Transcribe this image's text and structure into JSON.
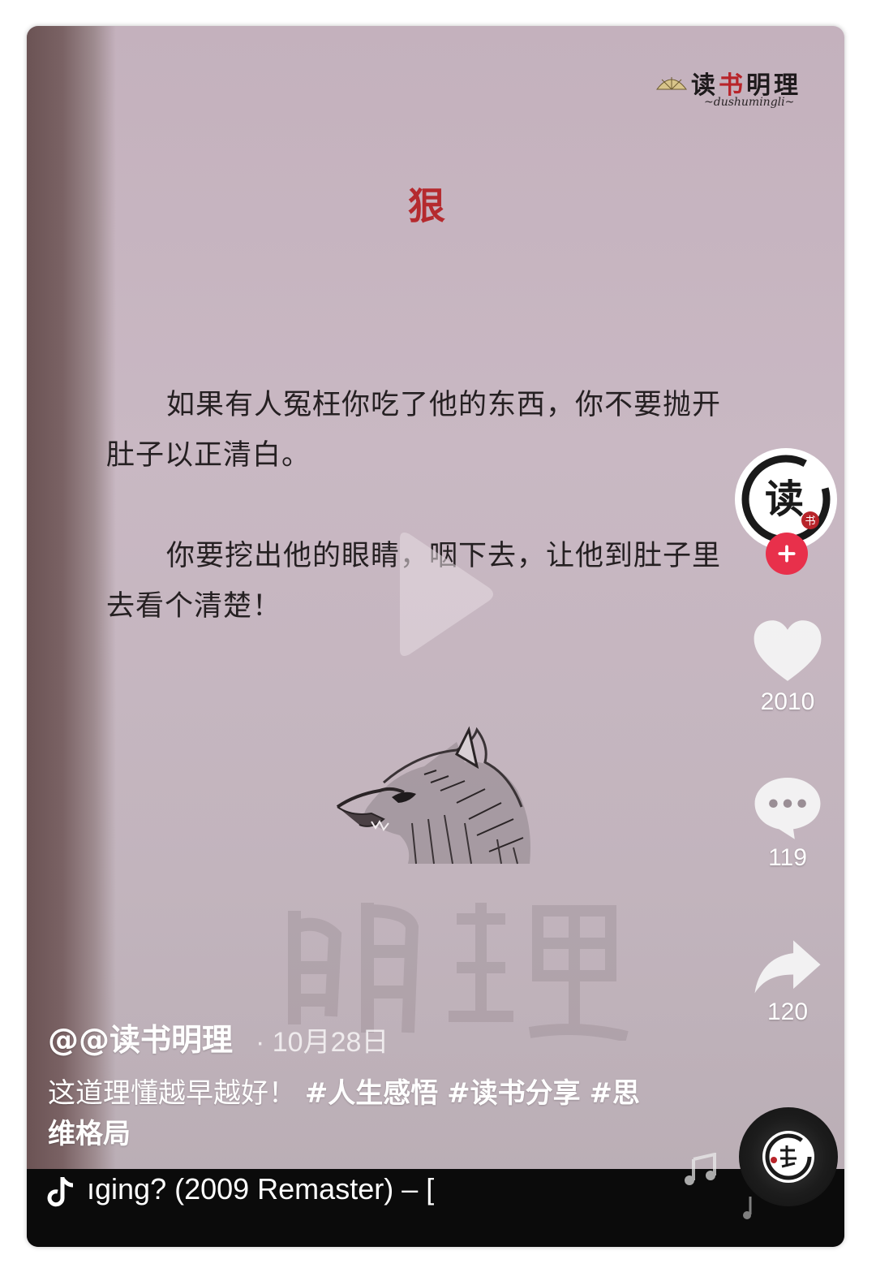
{
  "brand": {
    "title_a": "读",
    "title_b": "书",
    "title_c": "明理",
    "subtitle": "~dushumingli~"
  },
  "post": {
    "title": "狠",
    "paragraph1": "如果有人冤枉你吃了他的东西，你不要抛开肚子以正清白。",
    "paragraph2": "你要挖出他的眼睛，咽下去，让他到肚子里去看个清楚！"
  },
  "avatar": {
    "glyph": "读",
    "seal": "书"
  },
  "actions": {
    "likes": "2010",
    "comments": "119",
    "shares": "120"
  },
  "meta": {
    "author": "@@读书明理",
    "date": "· 10月28日",
    "caption_text": "这道理懂越早越好！",
    "tag1": "#人生感悟",
    "tag2": "#读书分享",
    "tag3": "#思维格局"
  },
  "music": {
    "text": "ıging? (2009 Remaster) – ["
  },
  "colors": {
    "accent_red": "#e8304b",
    "title_red": "#b52a2e",
    "background": "#c6b5c0"
  },
  "icons": [
    "play-icon",
    "plus-icon",
    "heart-icon",
    "comment-icon",
    "share-icon",
    "music-note-icon",
    "disc-icon"
  ]
}
